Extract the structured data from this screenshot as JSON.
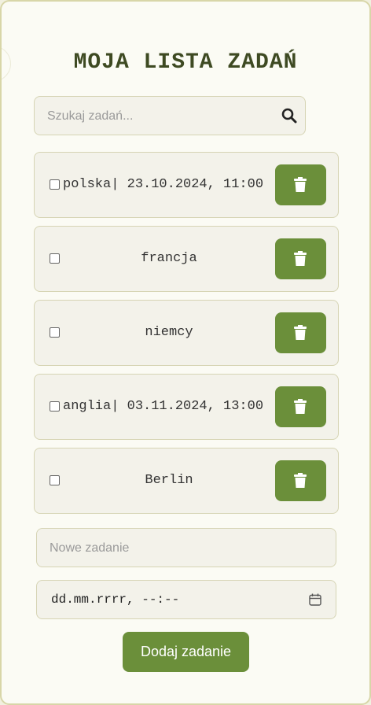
{
  "title": "MOJA LISTA ZADAŃ",
  "search": {
    "placeholder": "Szukaj zadań..."
  },
  "tasks": [
    {
      "text": "polska| 23.10.2024, 11:00",
      "align": "left"
    },
    {
      "text": "francja",
      "align": "center"
    },
    {
      "text": "niemcy",
      "align": "center"
    },
    {
      "text": "anglia| 03.11.2024, 13:00",
      "align": "left"
    },
    {
      "text": "Berlin",
      "align": "center"
    }
  ],
  "new_task": {
    "placeholder": "Nowe zadanie"
  },
  "date_input": {
    "placeholder": "dd.mm.rrrr, --:--"
  },
  "add_button": {
    "label": "Dodaj zadanie"
  },
  "icons": {
    "search": "search-icon",
    "delete": "trash-icon",
    "calendar": "calendar-icon"
  },
  "colors": {
    "accent": "#6b8f3a",
    "title": "#3e4a22",
    "background": "#fbfbf4"
  }
}
